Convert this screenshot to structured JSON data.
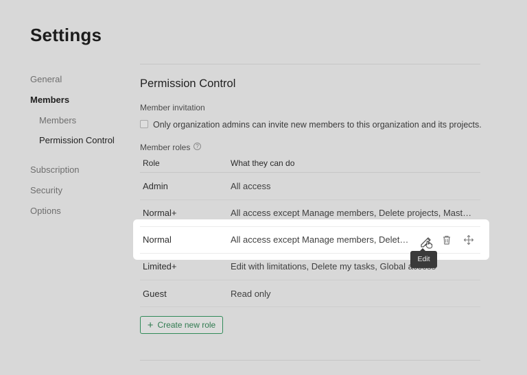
{
  "page": {
    "title": "Settings"
  },
  "sidebar": {
    "items": [
      {
        "label": "General"
      },
      {
        "label": "Members"
      },
      {
        "label": "Members"
      },
      {
        "label": "Permission Control"
      },
      {
        "label": "Subscription"
      },
      {
        "label": "Security"
      },
      {
        "label": "Options"
      }
    ]
  },
  "main": {
    "section_title": "Permission Control",
    "invitation": {
      "label": "Member invitation",
      "checkbox_label": "Only organization admins can invite new members to this organization and its projects.",
      "checked": false
    },
    "roles": {
      "label": "Member roles",
      "help_icon": "question-circle-icon",
      "columns": [
        "Role",
        "What they can do"
      ],
      "rows": [
        {
          "role": "Admin",
          "description": "All access"
        },
        {
          "role": "Normal+",
          "description": "All access except Manage members, Delete projects, Master..."
        },
        {
          "role": "Normal",
          "description": "All access except Manage members, Delete..."
        },
        {
          "role": "Limited+",
          "description": "Edit with limitations, Delete my tasks, Global access"
        },
        {
          "role": "Guest",
          "description": "Read only"
        }
      ],
      "row_actions": {
        "edit": "pencil-icon",
        "delete": "trash-icon",
        "move": "move-arrows-icon"
      },
      "tooltip": "Edit"
    },
    "create_button": {
      "icon": "plus-icon",
      "label": "Create new role"
    }
  },
  "colors": {
    "accent": "#2f8a57",
    "background": "#d8d8d8",
    "highlight": "#ffffff"
  }
}
